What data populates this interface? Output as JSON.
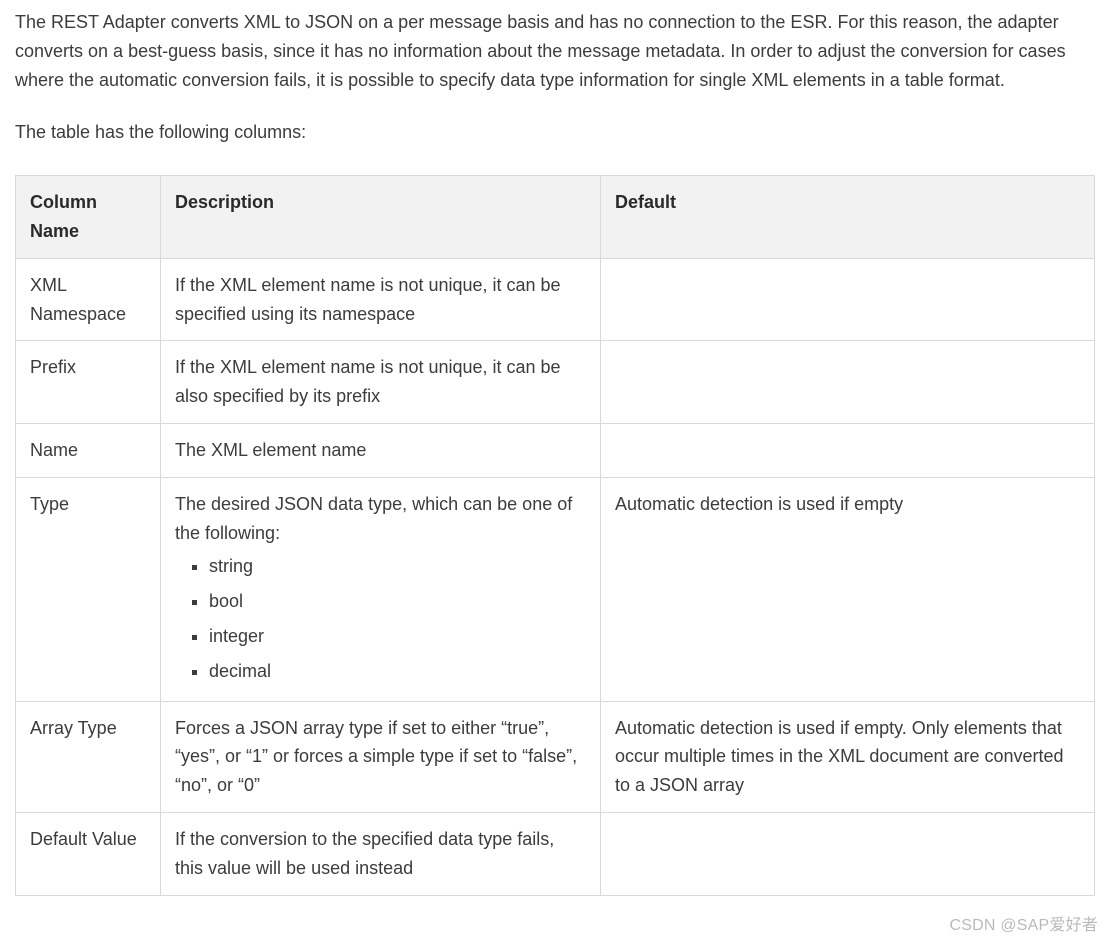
{
  "intro": "The REST Adapter converts XML to JSON on a per message basis and has no connection to the ESR. For this reason, the adapter converts on a best-guess basis, since it has no information about the message metadata. In order to adjust the conversion for cases where the automatic conversion fails, it is possible to specify data type information for single XML elements in a table format.",
  "subtitle": "The table has the following columns:",
  "headers": {
    "col1": "Column Name",
    "col2": "Description",
    "col3": "Default"
  },
  "rows": {
    "r0": {
      "name": "XML Namespace",
      "desc": "If the XML element name is not unique, it can be specified using its namespace",
      "def": ""
    },
    "r1": {
      "name": "Prefix",
      "desc": "If the XML element name is not unique, it can be also specified by its prefix",
      "def": ""
    },
    "r2": {
      "name": "Name",
      "desc": "The XML element name",
      "def": ""
    },
    "r3": {
      "name": "Type",
      "desc_intro": "The desired JSON data type, which can be one of the following:",
      "types": {
        "t0": "string",
        "t1": "bool",
        "t2": "integer",
        "t3": "decimal"
      },
      "def": "Automatic detection is used if empty"
    },
    "r4": {
      "name": "Array Type",
      "desc": "Forces a JSON array type if set to either “true”, “yes”, or “1” or forces a simple type if set to “false”, “no”, or “0”",
      "def": "Automatic detection is used if empty. Only elements that occur multiple times in the XML document are converted to a JSON array"
    },
    "r5": {
      "name": "Default Value",
      "desc": "If the conversion to the specified data type fails, this value will be used instead",
      "def": ""
    }
  },
  "watermark": "CSDN @SAP爱好者"
}
